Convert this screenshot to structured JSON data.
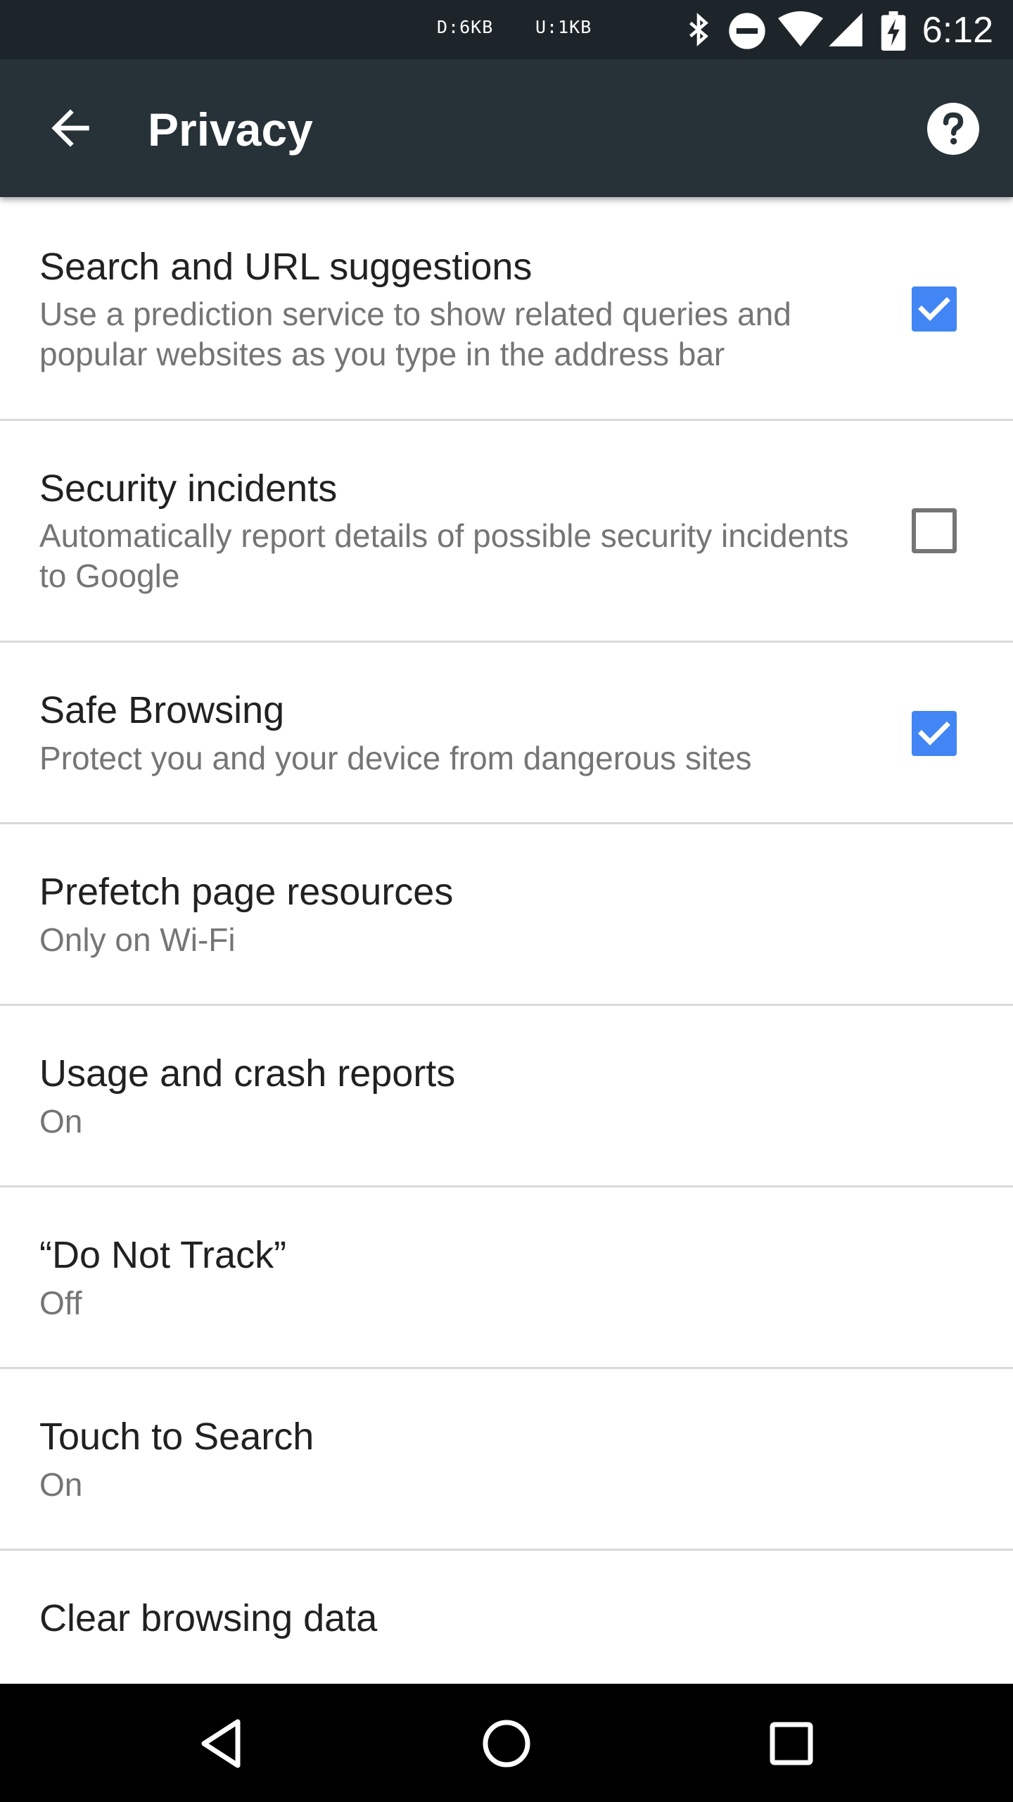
{
  "status_bar": {
    "down": "D:6KB",
    "up": "U:1KB",
    "time": "6:12",
    "icons": [
      "bluetooth-icon",
      "do-not-disturb-icon",
      "wifi-icon",
      "cell-signal-icon",
      "battery-charging-icon"
    ]
  },
  "app_bar": {
    "title": "Privacy",
    "back_icon": "arrow-back-icon",
    "help_icon": "help-icon",
    "background": "#263238"
  },
  "settings": [
    {
      "title": "Search and URL suggestions",
      "summary": "Use a prediction service to show related queries and popular websites as you type in the address bar",
      "checkbox": true,
      "checked": true
    },
    {
      "title": "Security incidents",
      "summary": "Automatically report details of possible security incidents to Google",
      "checkbox": true,
      "checked": false
    },
    {
      "title": "Safe Browsing",
      "summary": "Protect you and your device from dangerous sites",
      "checkbox": true,
      "checked": true
    },
    {
      "title": "Prefetch page resources",
      "summary": "Only on Wi-Fi"
    },
    {
      "title": "Usage and crash reports",
      "summary": "On"
    },
    {
      "title": "“Do Not Track”",
      "summary": "Off"
    },
    {
      "title": "Touch to Search",
      "summary": "On"
    },
    {
      "title": "Clear browsing data"
    }
  ],
  "nav_bar": {
    "icons": [
      "back-triangle-icon",
      "home-circle-icon",
      "recents-square-icon"
    ]
  },
  "colors": {
    "accent": "#4285f4",
    "status_bar": "#1e252a",
    "nav_bar": "#000000"
  }
}
